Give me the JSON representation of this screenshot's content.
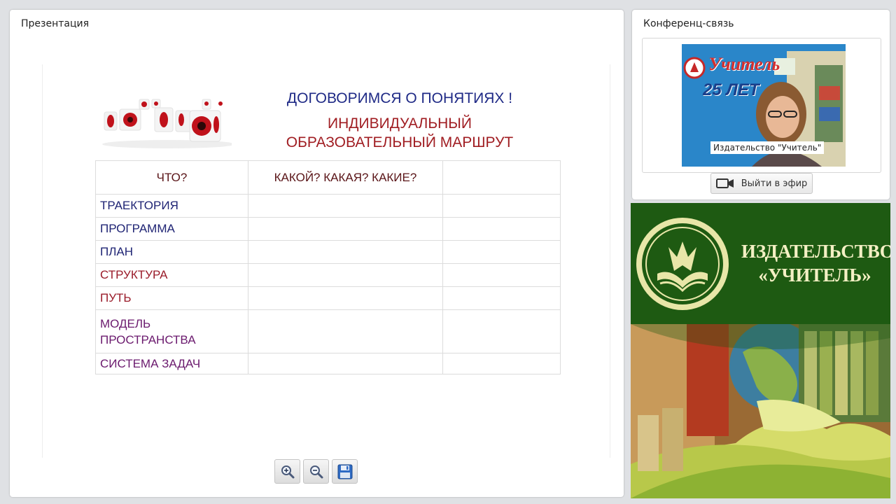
{
  "presentation": {
    "title": "Презентация",
    "slide": {
      "heading": "ДОГОВОРИМСЯ О ПОНЯТИЯХ !",
      "subheading_line1": "ИНДИВИДУАЛЬНЫЙ",
      "subheading_line2": "ОБРАЗОВАТЕЛЬНЫЙ МАРШРУТ",
      "table": {
        "header": [
          "ЧТО?",
          "КАКОЙ? КАКАЯ? КАКИЕ?",
          ""
        ],
        "rows": [
          {
            "label": "ТРАЕКТОРИЯ",
            "color": "#1f2474"
          },
          {
            "label": "ПРОГРАММА",
            "color": "#1f2474"
          },
          {
            "label": "ПЛАН",
            "color": "#1f2474"
          },
          {
            "label": "СТРУКТУРА",
            "color": "#9a1c2a"
          },
          {
            "label": "ПУТЬ",
            "color": "#9a1c2a"
          },
          {
            "label_line1": "МОДЕЛЬ",
            "label_line2": "ПРОСТРАНСТВА",
            "color": "#6b1a6e"
          },
          {
            "label": "СИСТЕМА ЗАДАЧ",
            "color": "#6b1a6e"
          }
        ]
      }
    },
    "toolbar": {
      "zoom_in_icon": "zoom-in-icon",
      "zoom_out_icon": "zoom-out-icon",
      "save_icon": "floppy-disk-icon"
    }
  },
  "conference": {
    "title": "Конференц-связь",
    "video_caption": "Издательство \"Учитель\"",
    "video_poster": {
      "brand": "Учитель",
      "years": "25 ЛЕТ"
    },
    "exit_button_label": "Выйти в эфир",
    "exit_button_icon": "camera-icon"
  },
  "ad_banner": {
    "line1": "ИЗДАТЕЛЬСТВО",
    "line2": "«УЧИТЕЛЬ»",
    "brand_color": "#1e5a12",
    "text_color": "#f4f0c4"
  }
}
